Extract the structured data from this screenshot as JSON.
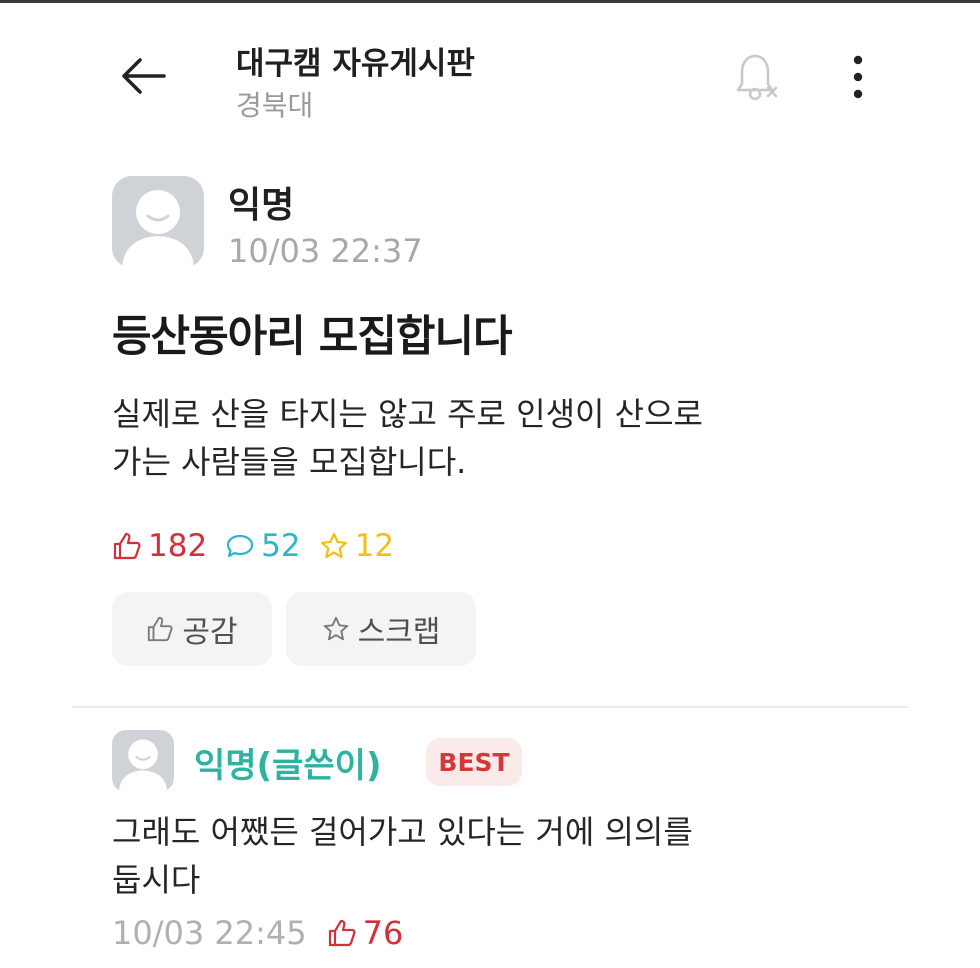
{
  "header": {
    "title": "대구캠 자유게시판",
    "subtitle": "경북대",
    "back_icon": "arrow-left-icon",
    "bell_icon": "bell-off-icon",
    "more_icon": "more-vertical-icon"
  },
  "post": {
    "author": "익명",
    "time": "10/03 22:37",
    "title": "등산동아리 모집합니다",
    "body_lines": [
      "실제로 산을 타지는 않고 주로 인생이 산으로",
      "가는 사람들을 모집합니다."
    ],
    "stats": {
      "likes": "182",
      "comments": "52",
      "scraps": "12"
    },
    "actions": {
      "like_label": "공감",
      "scrap_label": "스크랩"
    }
  },
  "comment": {
    "author": "익명(글쓴이)",
    "badge": "BEST",
    "body_lines": [
      "그래도 어쨌든 걸어가고 있다는 거에 의의를",
      "둡시다"
    ],
    "time": "10/03 22:45",
    "likes": "76"
  },
  "colors": {
    "like": "#d2303b",
    "comment": "#2cb6c7",
    "scrap": "#f2bf1a",
    "comment_author": "#2db3a2",
    "badge_text": "#d23a3a",
    "badge_bg": "#fbeaea"
  }
}
